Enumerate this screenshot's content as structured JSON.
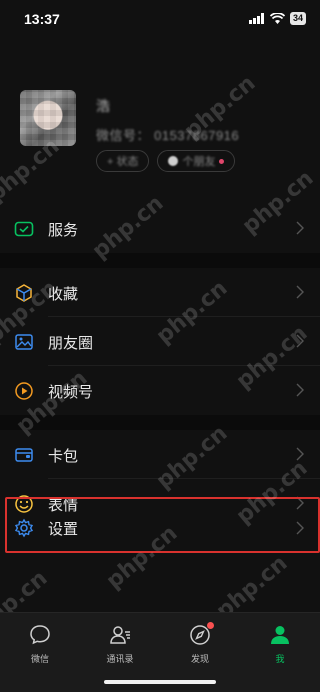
{
  "status_bar": {
    "time": "13:37",
    "battery": "34"
  },
  "profile": {
    "name": "浩",
    "wechat_id": "微信号： 01537867916",
    "status_chip": "+ 状态",
    "friends_chip": "个朋友"
  },
  "menu": [
    {
      "key": "services",
      "label": "服务",
      "icon": "services-icon",
      "color": "#07c160"
    },
    {
      "key": "favorites",
      "label": "收藏",
      "icon": "favorites-cube-icon",
      "color": "#f7b53a"
    },
    {
      "key": "moments",
      "label": "朋友圈",
      "icon": "moments-picture-icon",
      "color": "#3d8cf0"
    },
    {
      "key": "channels",
      "label": "视频号",
      "icon": "channels-play-icon",
      "color": "#f39a21"
    },
    {
      "key": "cards",
      "label": "卡包",
      "icon": "card-wallet-icon",
      "color": "#3d8cf0"
    },
    {
      "key": "stickers",
      "label": "表情",
      "icon": "sticker-smile-icon",
      "color": "#f7c340"
    }
  ],
  "settings": {
    "label": "设置",
    "icon": "gear-icon",
    "color": "#3d8cf0"
  },
  "tabbar": [
    {
      "key": "chats",
      "label": "微信",
      "icon": "chat-bubble-icon",
      "active": false
    },
    {
      "key": "contacts",
      "label": "通讯录",
      "icon": "contacts-icon",
      "active": false
    },
    {
      "key": "discover",
      "label": "发现",
      "icon": "compass-icon",
      "active": false
    },
    {
      "key": "me",
      "label": "我",
      "icon": "person-icon",
      "active": true
    }
  ],
  "colors": {
    "accent": "#07c160",
    "highlight_box": "#d9322e",
    "badge": "#fa5151"
  },
  "watermark": "php.cn"
}
